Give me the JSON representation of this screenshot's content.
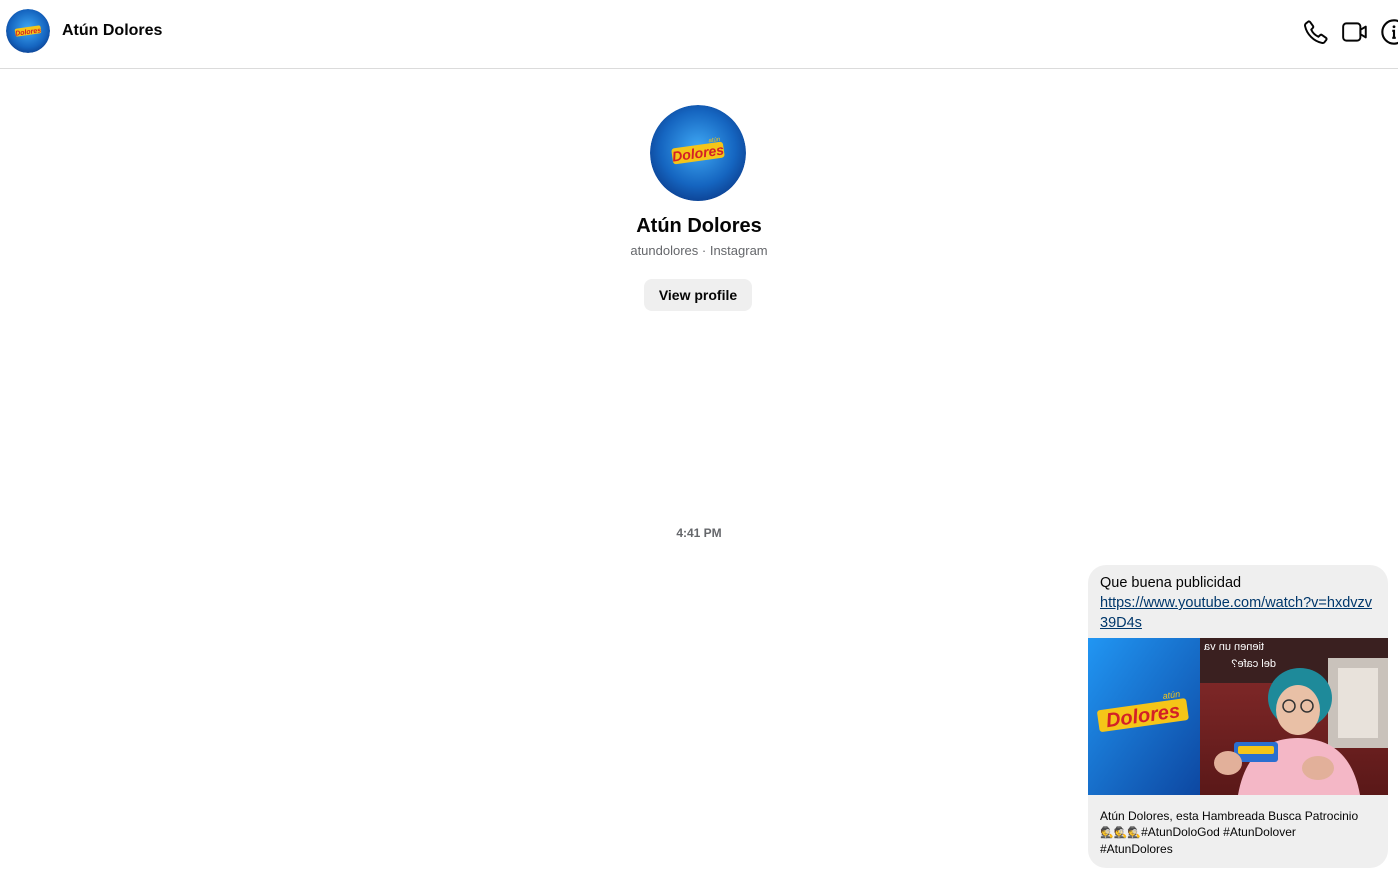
{
  "header": {
    "contact_name": "Atún Dolores",
    "icons": [
      "phone-icon",
      "video-call-icon",
      "info-icon"
    ]
  },
  "profile": {
    "name": "Atún Dolores",
    "subtitle": "atundolores · Instagram",
    "view_profile_label": "View profile",
    "logo_text": "Dolores",
    "logo_small_text": "atún"
  },
  "conversation": {
    "timestamp": "4:41 PM",
    "message": {
      "text": "Que buena publicidad",
      "link": "https://www.youtube.com/watch?v=hxdvzv39D4s",
      "preview": {
        "overlay_line1": "tienen un va",
        "overlay_line2": "del cafe?",
        "caption_line1": "Atún Dolores, esta Hambreada Busca Patrocinio",
        "caption_line2": "#AtunDoloGod #AtunDolover",
        "caption_line3": "#AtunDolores"
      }
    }
  },
  "colors": {
    "brand_blue": "#1f6fd6",
    "brand_red": "#d32027",
    "link": "#00376b",
    "bubble_bg": "#efefef"
  }
}
